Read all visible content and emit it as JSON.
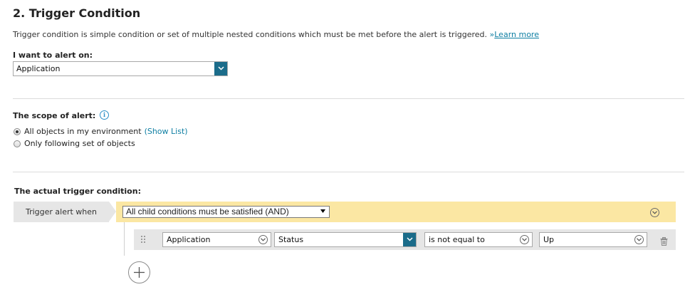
{
  "section": {
    "title": "2. Trigger Condition",
    "description": "Trigger condition is simple condition or set of multiple nested conditions which must be met before the alert is triggered.",
    "learn_more_prefix": "»",
    "learn_more_label": "Learn more"
  },
  "alert_on": {
    "label": "I want to alert on:",
    "value": "Application"
  },
  "scope": {
    "label": "The scope of alert:",
    "options": [
      {
        "label": "All objects in my environment",
        "link": "(Show List)",
        "selected": true
      },
      {
        "label": "Only following set of objects",
        "selected": false
      }
    ]
  },
  "trigger": {
    "label": "The actual trigger condition:",
    "when_label": "Trigger alert when",
    "logic_value": "All child conditions must be satisfied (AND)",
    "condition": {
      "object": "Application",
      "property": "Status",
      "operator": "is not equal to",
      "value": "Up"
    }
  },
  "icons": {
    "info": "info-icon",
    "drag": "drag-handle-icon",
    "delete": "trash-icon",
    "add": "plus-icon",
    "expand": "chevron-down-icon"
  },
  "colors": {
    "accent": "#1b6c8a",
    "link": "#0f7fa3",
    "condition_bar": "#fbe7a3",
    "panel": "#e6e6e6"
  }
}
